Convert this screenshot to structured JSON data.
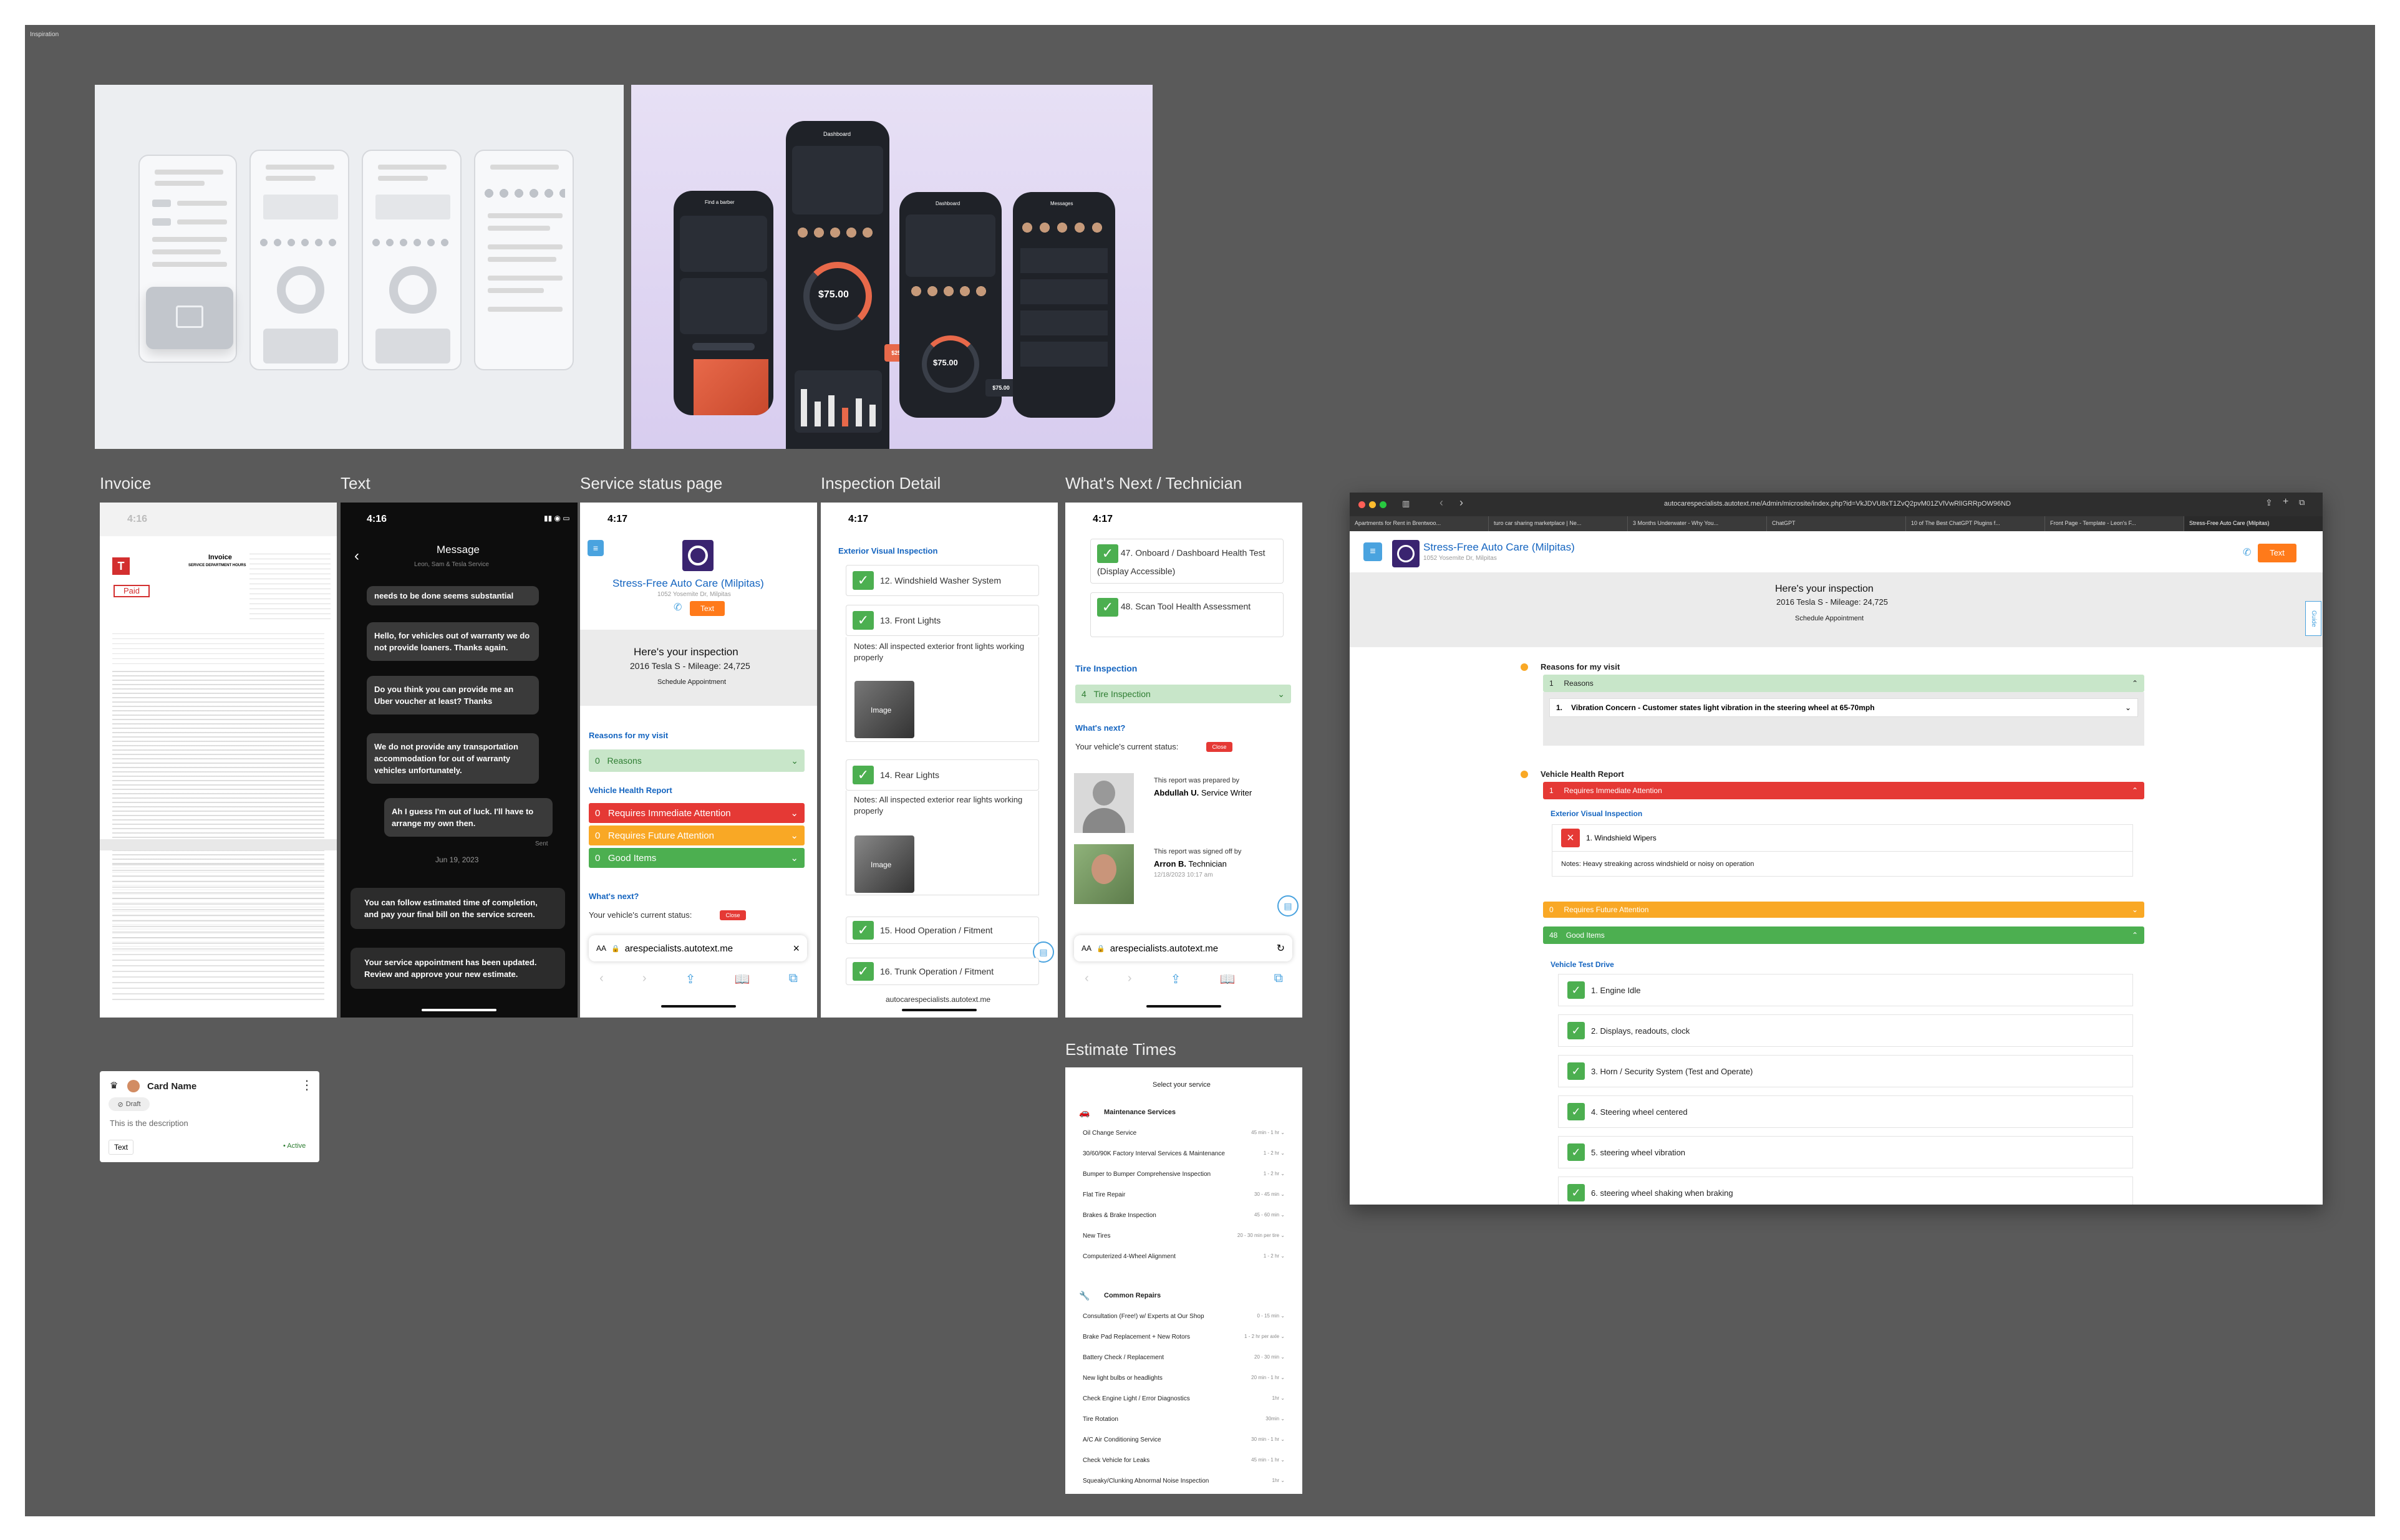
{
  "canvas": {
    "title": "Inspiration"
  },
  "frames": {
    "invoice": "Invoice",
    "text": "Text",
    "service_status": "Service status page",
    "inspection_detail": "Inspection Detail",
    "whats_next": "What's Next / Technician",
    "estimate_times": "Estimate Times"
  },
  "mockup": {
    "dashboard": "Dashboard",
    "find_barber": "Find a barber",
    "messages": "Messages",
    "amount": "$75.00",
    "badge1": "$25.00",
    "badge2": "$75.00"
  },
  "invoice": {
    "time": "4:16",
    "title": "Invoice",
    "paid": "Paid",
    "subtitle": "SERVICE DEPARTMENT HOURS"
  },
  "text_shot": {
    "time": "4:16",
    "header": "Message",
    "subheader": "Leon, Sam & Tesla Service",
    "msgs": [
      "needs to be done seems substantial",
      "Hello, for vehicles out of warranty we do not provide loaners. Thanks again.",
      "Do you think you can provide me an Uber voucher at least? Thanks",
      "We do not provide any transportation accommodation for out of warranty vehicles unfortunately.",
      "Ah I guess I'm out of luck. I'll have to arrange my own then."
    ],
    "sent": "Sent",
    "date": "Jun 19, 2023",
    "notice1": "You can follow estimated time of completion, and pay your final bill on the service screen.",
    "notice2": "Your service appointment has been updated. Review and approve your new estimate."
  },
  "service_status": {
    "time": "4:17",
    "business": "Stress-Free Auto Care (Milpitas)",
    "address": "1052 Yosemite Dr, Milpitas",
    "text_btn": "Text",
    "heading": "Here's your inspection",
    "vehicle": "2016 Tesla S - Mileage: 24,725",
    "schedule": "Schedule Appointment",
    "reasons_title": "Reasons for my visit",
    "reasons_count": "0",
    "reasons_label": "Reasons",
    "report_title": "Vehicle Health Report",
    "immediate_count": "0",
    "immediate": "Requires Immediate Attention",
    "future_count": "0",
    "future": "Requires Future Attention",
    "good_count": "0",
    "good": "Good Items",
    "whats_next": "What's next?",
    "status_label": "Your vehicle's current status:",
    "status_badge": "Close",
    "url": "arespecialists.autotext.me",
    "aa": "AA"
  },
  "inspection_detail": {
    "time": "4:17",
    "section": "Exterior Visual Inspection",
    "item1": "12. Windshield Washer System",
    "item2": "13. Front Lights",
    "note1": "Notes: All inspected exterior front lights working properly",
    "image_label": "Image",
    "item3": "14. Rear Lights",
    "note2": "Notes: All inspected exterior rear lights working properly",
    "item4": "15. Hood Operation / Fitment",
    "item5": "16. Trunk Operation / Fitment",
    "url": "autocarespecialists.autotext.me"
  },
  "whats_next_shot": {
    "time": "4:17",
    "item47": "47. Onboard / Dashboard Health Test (Display Accessible)",
    "item48": "48. Scan Tool Health Assessment",
    "tire_title": "Tire Inspection",
    "tire_count": "4",
    "tire_label": "Tire Inspection",
    "whats_next": "What's next?",
    "status_label": "Your vehicle's current status:",
    "status_badge": "Close",
    "prepared": "This report was prepared by",
    "writer_name": "Abdullah U.",
    "writer_role": "Service Writer",
    "signed": "This report was signed off by",
    "tech_name": "Arron B.",
    "tech_role": "Technician",
    "tech_date": "12/18/2023 10:17 am",
    "url": "arespecialists.autotext.me",
    "aa": "AA"
  },
  "card": {
    "name": "Card Name",
    "tag": "Draft",
    "desc": "This is the description",
    "text_btn": "Text",
    "status": "• Active"
  },
  "estimate": {
    "title": "Select your service",
    "cat1": "Maintenance Services",
    "maint": [
      {
        "name": "Oil Change Service",
        "time": "45 min - 1 hr"
      },
      {
        "name": "30/60/90K Factory Interval Services & Maintenance",
        "time": "1 - 2 hr"
      },
      {
        "name": "Bumper to Bumper Comprehensive Inspection",
        "time": "1 - 2 hr"
      },
      {
        "name": "Flat Tire Repair",
        "time": "30 - 45 min"
      },
      {
        "name": "Brakes & Brake Inspection",
        "time": "45 - 60 min"
      },
      {
        "name": "New Tires",
        "time": "20 - 30 min per tire"
      },
      {
        "name": "Computerized 4-Wheel Alignment",
        "time": "1 - 2 hr"
      }
    ],
    "cat2": "Common Repairs",
    "repairs": [
      {
        "name": "Consultation (Free!) w/ Experts at Our Shop",
        "time": "0 - 15 min"
      },
      {
        "name": "Brake Pad Replacement + New Rotors",
        "time": "1 - 2 hr per axle"
      },
      {
        "name": "Battery Check / Replacement",
        "time": "20 - 30 min"
      },
      {
        "name": "New light bulbs or headlights",
        "time": "20 min - 1 hr"
      },
      {
        "name": "Check Engine Light / Error Diagnostics",
        "time": "1hr"
      },
      {
        "name": "Tire Rotation",
        "time": "30min"
      },
      {
        "name": "A/C Air Conditioning Service",
        "time": "30 min - 1 hr"
      },
      {
        "name": "Check Vehicle for Leaks",
        "time": "45 min - 1 hr"
      },
      {
        "name": "Squeaky/Clunking Abnormal Noise Inspection",
        "time": "1hr"
      }
    ]
  },
  "browser": {
    "url": "autocarespecialists.autotext.me/Admin/microsite/index.php?id=VkJDVU8xT1ZvQ2pvM01ZVlVwRlIGRRpOW96ND",
    "tabs": [
      "Apartments for Rent in Brentwoo...",
      "turo car sharing marketplace | Ne...",
      "3 Months Underwater - Why You...",
      "ChatGPT",
      "10 of The Best ChatGPT Plugins f...",
      "Front Page - Template - Leon's F...",
      "Stress-Free Auto Care (Milpitas)"
    ],
    "business": "Stress-Free Auto Care (Milpitas)",
    "address": "1052 Yosemite Dr, Milpitas",
    "text_btn": "Text",
    "heading": "Here's your inspection",
    "vehicle": "2016 Tesla S - Mileage: 24,725",
    "schedule": "Schedule Appointment",
    "guide": "Guide",
    "reasons_title": "Reasons for my visit",
    "reasons_count": "1",
    "reasons_label": "Reasons",
    "concern_num": "1.",
    "concern": "Vibration Concern - Customer states light vibration in the steering wheel at 65-70mph",
    "report_title": "Vehicle Health Report",
    "immediate_count": "1",
    "immediate": "Requires Immediate Attention",
    "ext_section": "Exterior Visual Inspection",
    "wipers": "1. Windshield Wipers",
    "wipers_note": "Notes: Heavy streaking across windshield or noisy on operation",
    "future_count": "0",
    "future": "Requires Future Attention",
    "good_count": "48",
    "good": "Good Items",
    "drive_section": "Vehicle Test Drive",
    "drive_items": [
      "1. Engine Idle",
      "2. Displays, readouts, clock",
      "3. Horn / Security System (Test and Operate)",
      "4. Steering wheel centered",
      "5. steering wheel vibration",
      "6. steering wheel shaking when braking"
    ]
  },
  "colors": {
    "canvas": "#5a5a5a",
    "green": "#4caf50",
    "red": "#e53935",
    "orange": "#f9a825",
    "blue_link": "#1565c0",
    "accent_orange": "#ff7a1a"
  }
}
